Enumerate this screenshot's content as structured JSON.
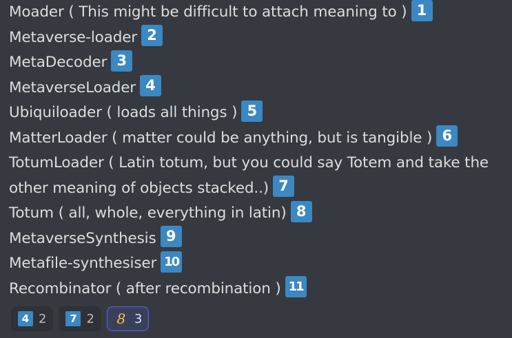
{
  "colors": {
    "background": "#36393f",
    "text": "#dcddde",
    "keycap": "#3b88c3",
    "reaction_bg": "#2f3136",
    "reaction_active_bg": "#3b405a",
    "reaction_active_border": "#5865f2"
  },
  "message": {
    "lines": [
      {
        "text": "Moader ( This might be difficult to attach meaning to )",
        "badge": "1"
      },
      {
        "text": "Metaverse-loader",
        "badge": "2"
      },
      {
        "text": "MetaDecoder",
        "badge": "3"
      },
      {
        "text": "MetaverseLoader",
        "badge": "4"
      },
      {
        "text": "Ubiquiloader ( loads all things )",
        "badge": "5"
      },
      {
        "text": "MatterLoader ( matter could be anything, but is tangible )",
        "badge": "6"
      },
      {
        "text": "TotumLoader ( Latin totum, but you could say Totem and take the other meaning of objects stacked..)",
        "badge": "7"
      },
      {
        "text": "Totum ( all, whole, everything in latin)",
        "badge": "8"
      },
      {
        "text": "MetaverseSynthesis",
        "badge": "9"
      },
      {
        "text": "Metafile-synthesiser",
        "badge": "10"
      },
      {
        "text": "Recombinator ( after recombination )",
        "badge": "11"
      }
    ]
  },
  "reactions": [
    {
      "emoji": "4",
      "icon": "keycap-4-icon",
      "count": "2",
      "active": false
    },
    {
      "emoji": "7",
      "icon": "keycap-7-icon",
      "count": "2",
      "active": false
    },
    {
      "emoji": "8",
      "icon": "eight-icon",
      "count": "3",
      "active": true
    }
  ]
}
